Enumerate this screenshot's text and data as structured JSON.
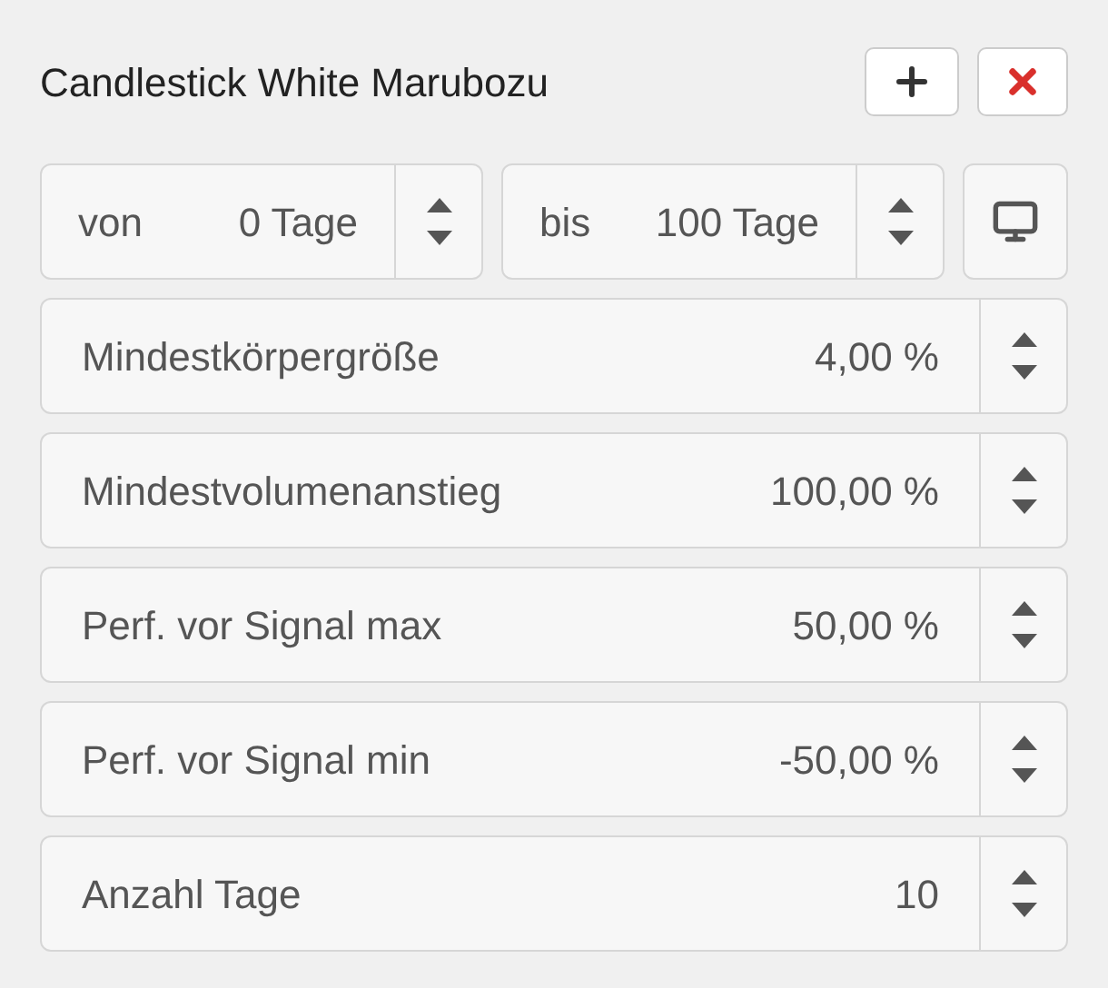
{
  "title": "Candlestick White Marubozu",
  "range": [
    {
      "prefix": "von",
      "value": "0 Tage"
    },
    {
      "prefix": "bis",
      "value": "100 Tage"
    }
  ],
  "params": [
    {
      "label": "Mindestkörpergröße",
      "value": "4,00 %"
    },
    {
      "label": "Mindestvolumenanstieg",
      "value": "100,00 %"
    },
    {
      "label": "Perf. vor Signal max",
      "value": "50,00 %"
    },
    {
      "label": "Perf. vor Signal min",
      "value": "-50,00 %"
    },
    {
      "label": "Anzahl Tage",
      "value": "10"
    }
  ]
}
